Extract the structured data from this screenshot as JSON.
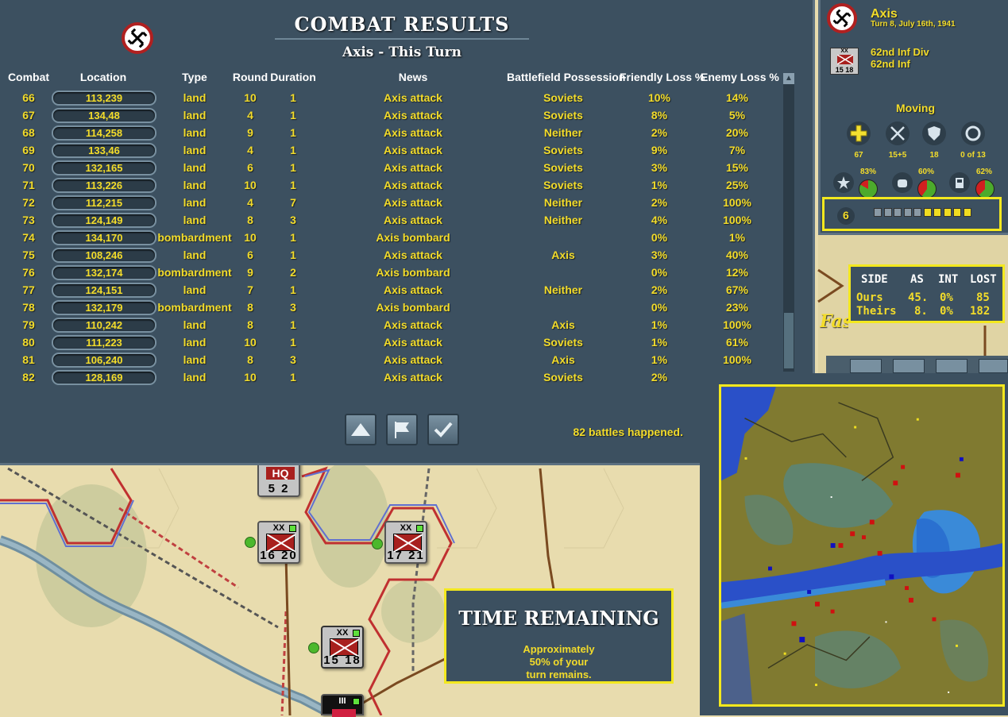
{
  "combat_panel": {
    "title": "COMBAT RESULTS",
    "subtitle": "Axis - This Turn",
    "columns": [
      "Combat",
      "Location",
      "Type",
      "Round",
      "Duration",
      "News",
      "Battlefield Possession",
      "Friendly Loss %",
      "Enemy Loss %"
    ],
    "rows": [
      {
        "combat": "66",
        "location": "113,239",
        "type": "land",
        "round": "10",
        "duration": "1",
        "news": "Axis attack",
        "possession": "Soviets",
        "friendly": "10%",
        "enemy": "14%"
      },
      {
        "combat": "67",
        "location": "134,48",
        "type": "land",
        "round": "4",
        "duration": "1",
        "news": "Axis attack",
        "possession": "Soviets",
        "friendly": "8%",
        "enemy": "5%"
      },
      {
        "combat": "68",
        "location": "114,258",
        "type": "land",
        "round": "9",
        "duration": "1",
        "news": "Axis attack",
        "possession": "Neither",
        "friendly": "2%",
        "enemy": "20%"
      },
      {
        "combat": "69",
        "location": "133,46",
        "type": "land",
        "round": "4",
        "duration": "1",
        "news": "Axis attack",
        "possession": "Soviets",
        "friendly": "9%",
        "enemy": "7%"
      },
      {
        "combat": "70",
        "location": "132,165",
        "type": "land",
        "round": "6",
        "duration": "1",
        "news": "Axis attack",
        "possession": "Soviets",
        "friendly": "3%",
        "enemy": "15%"
      },
      {
        "combat": "71",
        "location": "113,226",
        "type": "land",
        "round": "10",
        "duration": "1",
        "news": "Axis attack",
        "possession": "Soviets",
        "friendly": "1%",
        "enemy": "25%"
      },
      {
        "combat": "72",
        "location": "112,215",
        "type": "land",
        "round": "4",
        "duration": "7",
        "news": "Axis attack",
        "possession": "Neither",
        "friendly": "2%",
        "enemy": "100%"
      },
      {
        "combat": "73",
        "location": "124,149",
        "type": "land",
        "round": "8",
        "duration": "3",
        "news": "Axis attack",
        "possession": "Neither",
        "friendly": "4%",
        "enemy": "100%"
      },
      {
        "combat": "74",
        "location": "134,170",
        "type": "bombardment",
        "round": "10",
        "duration": "1",
        "news": "Axis bombard",
        "possession": "",
        "friendly": "0%",
        "enemy": "1%"
      },
      {
        "combat": "75",
        "location": "108,246",
        "type": "land",
        "round": "6",
        "duration": "1",
        "news": "Axis attack",
        "possession": "Axis",
        "friendly": "3%",
        "enemy": "40%"
      },
      {
        "combat": "76",
        "location": "132,174",
        "type": "bombardment",
        "round": "9",
        "duration": "2",
        "news": "Axis bombard",
        "possession": "",
        "friendly": "0%",
        "enemy": "12%"
      },
      {
        "combat": "77",
        "location": "124,151",
        "type": "land",
        "round": "7",
        "duration": "1",
        "news": "Axis attack",
        "possession": "Neither",
        "friendly": "2%",
        "enemy": "67%"
      },
      {
        "combat": "78",
        "location": "132,179",
        "type": "bombardment",
        "round": "8",
        "duration": "3",
        "news": "Axis bombard",
        "possession": "",
        "friendly": "0%",
        "enemy": "23%"
      },
      {
        "combat": "79",
        "location": "110,242",
        "type": "land",
        "round": "8",
        "duration": "1",
        "news": "Axis attack",
        "possession": "Axis",
        "friendly": "1%",
        "enemy": "100%"
      },
      {
        "combat": "80",
        "location": "111,223",
        "type": "land",
        "round": "10",
        "duration": "1",
        "news": "Axis attack",
        "possession": "Soviets",
        "friendly": "1%",
        "enemy": "61%"
      },
      {
        "combat": "81",
        "location": "106,240",
        "type": "land",
        "round": "8",
        "duration": "3",
        "news": "Axis attack",
        "possession": "Axis",
        "friendly": "1%",
        "enemy": "100%"
      },
      {
        "combat": "82",
        "location": "128,169",
        "type": "land",
        "round": "10",
        "duration": "1",
        "news": "Axis attack",
        "possession": "Soviets",
        "friendly": "2%",
        "enemy": ""
      }
    ],
    "battles_text": "82 battles happened."
  },
  "info_panel": {
    "side": "Axis",
    "turn_text": "Turn 8, July 16th, 1941",
    "unit_line1": "62nd Inf Div",
    "unit_line2": "62nd Inf",
    "unit_counter_top": "XX",
    "unit_counter_bottom": "15 18",
    "status": "Moving",
    "stats": [
      {
        "icon": "plus-icon",
        "value": "67"
      },
      {
        "icon": "crossed-swords-icon",
        "value": "15+5"
      },
      {
        "icon": "shield-icon",
        "value": "18"
      },
      {
        "icon": "ring-icon",
        "value": "0 of 13"
      }
    ],
    "percents": [
      {
        "icon": "star-icon",
        "value": "83%"
      },
      {
        "icon": "fist-icon",
        "value": "60%"
      },
      {
        "icon": "fuel-can-icon",
        "value": "62%"
      }
    ],
    "supply_value": "6",
    "supply_pips_filled": 5,
    "supply_pips_total": 10
  },
  "side_table": {
    "headers": [
      "SIDE",
      "AS",
      "INT",
      "LOST"
    ],
    "rows": [
      {
        "side": "Ours",
        "as": "45.",
        "int": "0%",
        "lost": "85"
      },
      {
        "side": "Theirs",
        "as": "8.",
        "int": "0%",
        "lost": "182"
      }
    ]
  },
  "map_label": "Fastov",
  "time_box": {
    "title": "TIME REMAINING",
    "line1": "Approximately",
    "line2": "50% of your",
    "line3": "turn remains."
  },
  "map_counters": [
    {
      "top": "HQ",
      "bottom": "5 2"
    },
    {
      "top": "XX",
      "bottom": "16 20"
    },
    {
      "top": "XX",
      "bottom": "17 21"
    },
    {
      "top": "XX",
      "bottom": "15 18"
    },
    {
      "top": "III",
      "bottom": ""
    }
  ],
  "colors": {
    "panel_bg": "#3c5060",
    "text_yellow": "#f3dc2a",
    "highlight_border": "#f3e81e",
    "map_bg": "#e8dcae",
    "unit_red": "#a8201e"
  }
}
